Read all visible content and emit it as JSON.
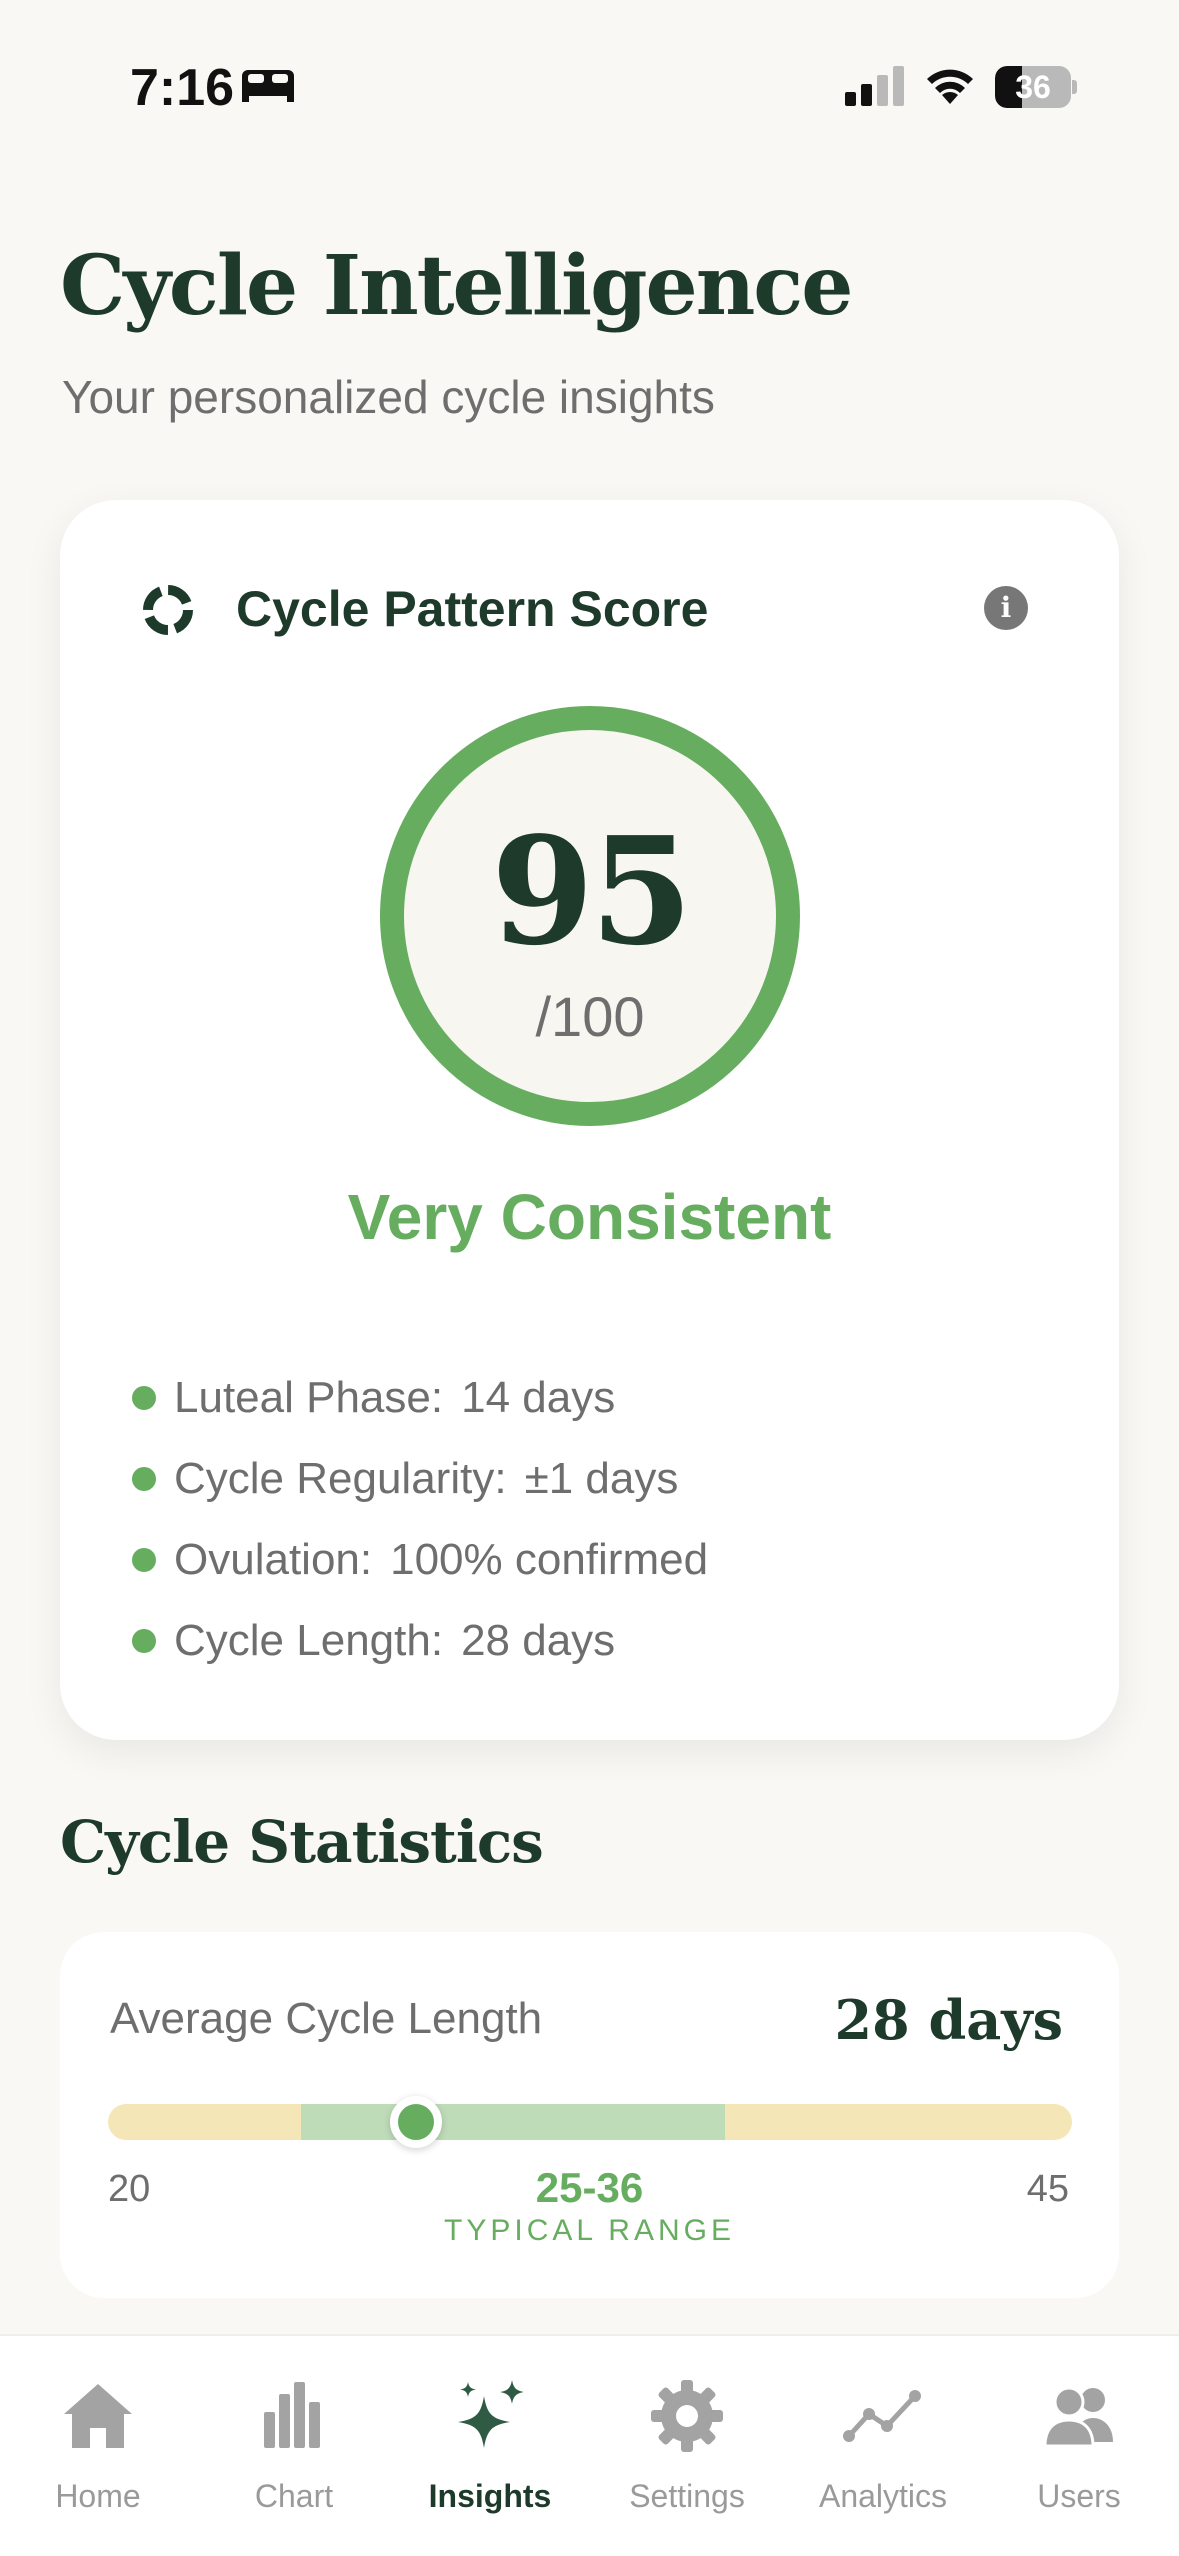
{
  "status_bar": {
    "time": "7:16",
    "battery_percent": "36",
    "battery_level": 0.36
  },
  "header": {
    "title": "Cycle Intelligence",
    "subtitle": "Your personalized cycle insights"
  },
  "score_card": {
    "title": "Cycle Pattern Score",
    "score": "95",
    "score_max": "/100",
    "score_fraction": 0.95,
    "rating": "Very Consistent",
    "metrics": [
      {
        "label": "Luteal Phase:",
        "value": "14 days"
      },
      {
        "label": "Cycle Regularity:",
        "value": "±1 days"
      },
      {
        "label": "Ovulation:",
        "value": "100% confirmed"
      },
      {
        "label": "Cycle Length:",
        "value": "28 days"
      }
    ]
  },
  "statistics": {
    "section_title": "Cycle Statistics",
    "average_cycle": {
      "label": "Average Cycle Length",
      "value": "28 days",
      "current": 28,
      "range_min": 20,
      "range_max": 45,
      "typical_min": 25,
      "typical_max": 36,
      "min_label": "20",
      "max_label": "45",
      "typical_label": "25-36",
      "typical_caption": "TYPICAL RANGE"
    }
  },
  "tabs": [
    {
      "label": "Home",
      "icon": "home-icon",
      "active": false
    },
    {
      "label": "Chart",
      "icon": "bar-chart-icon",
      "active": false
    },
    {
      "label": "Insights",
      "icon": "sparkles-icon",
      "active": true
    },
    {
      "label": "Settings",
      "icon": "gear-icon",
      "active": false
    },
    {
      "label": "Analytics",
      "icon": "trend-line-icon",
      "active": false
    },
    {
      "label": "Users",
      "icon": "users-icon",
      "active": false
    }
  ],
  "colors": {
    "accent_green": "#66ad60",
    "dark_green": "#1d3a2a",
    "range_typical": "#bfdcb8",
    "range_outside": "#f5e6b8"
  }
}
